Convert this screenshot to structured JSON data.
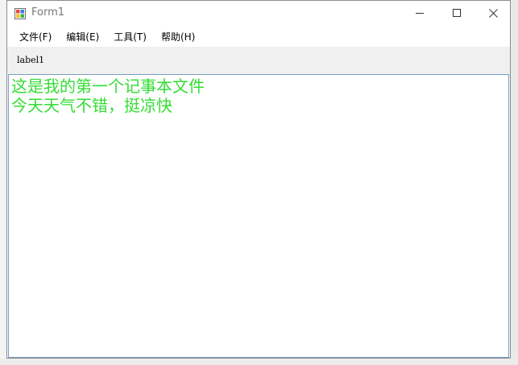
{
  "window": {
    "title": "Form1",
    "icon": "winforms-app-icon"
  },
  "title_buttons": {
    "minimize": "minimize-icon",
    "maximize": "maximize-icon",
    "close": "close-icon"
  },
  "menu": {
    "items": [
      {
        "label": "文件(F)"
      },
      {
        "label": "编辑(E)"
      },
      {
        "label": "工具(T)"
      },
      {
        "label": "帮助(H)"
      }
    ]
  },
  "toolbar": {
    "label": "label1"
  },
  "editor": {
    "lines": [
      "这是我的第一个记事本文件",
      "今天天气不错，挺凉快"
    ],
    "text_color": "#33dd33"
  }
}
